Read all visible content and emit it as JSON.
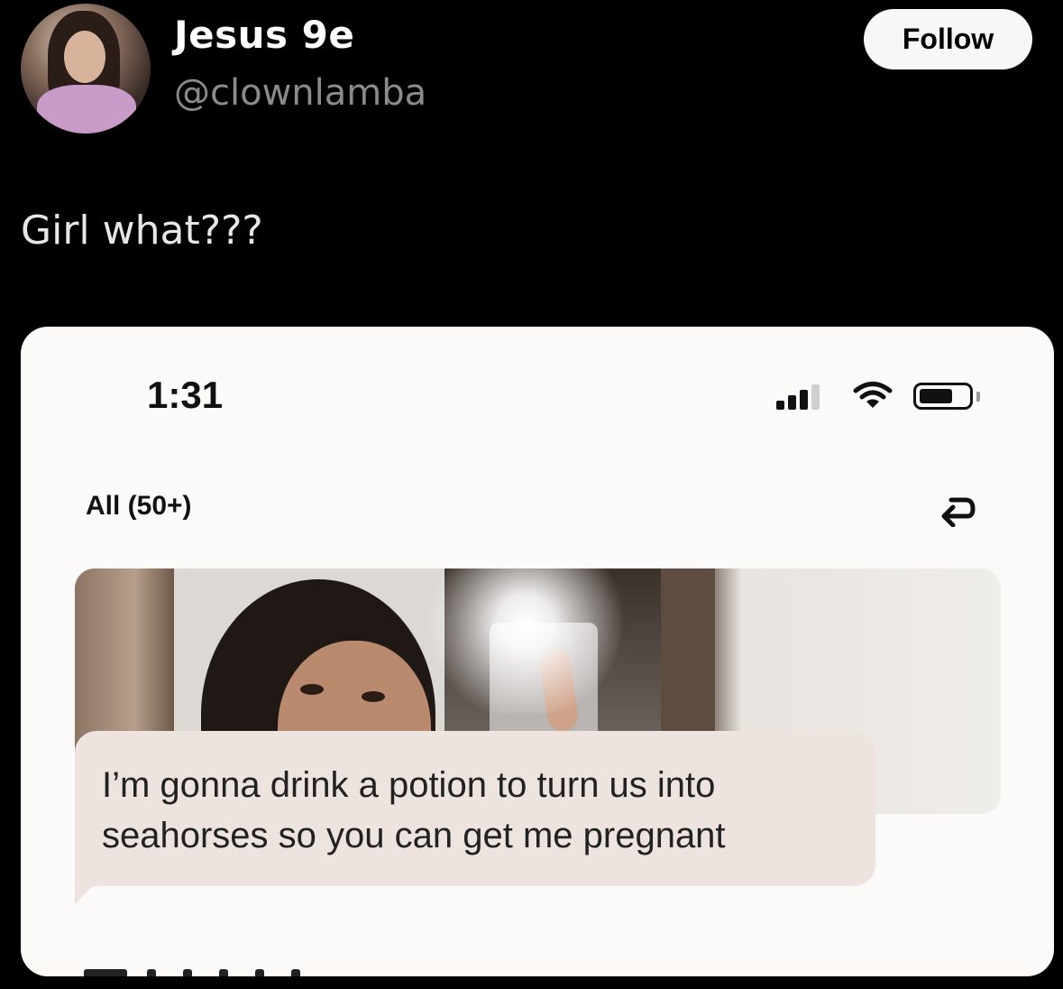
{
  "header": {
    "display_name": "Jesus 9e",
    "handle": "@clownlamba",
    "follow_label": "Follow"
  },
  "tweet": {
    "text": "Girl what???"
  },
  "screenshot": {
    "status_bar": {
      "time": "1:31"
    },
    "filter_label": "All (50+)",
    "message_text": "I’m gonna drink a potion to turn us into seahorses so you can get me pregnant"
  }
}
